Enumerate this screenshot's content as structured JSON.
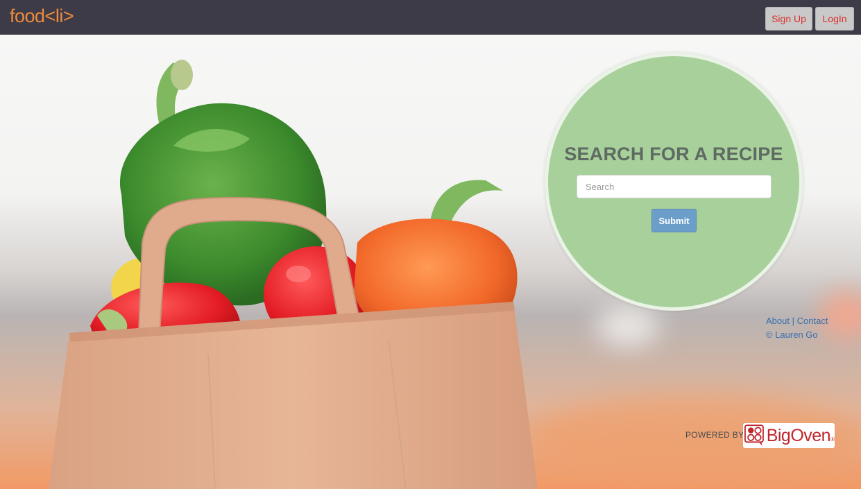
{
  "navbar": {
    "brand": "food<li>",
    "signup_label": "Sign Up",
    "login_label": "LogIn"
  },
  "search": {
    "title": "SEARCH FOR A RECIPE",
    "placeholder": "Search",
    "value": "",
    "submit_label": "Submit"
  },
  "footer": {
    "about_label": "About",
    "separator": "|",
    "contact_label": "Contact",
    "copyright": "© Lauren Go"
  },
  "powered_by": {
    "label": "POWERED BY",
    "logo_text": "BigOven",
    "logo_mark": "®"
  },
  "colors": {
    "navbar_bg": "#3c3b47",
    "brand": "#f08a3c",
    "nav_button_text": "#d9302c",
    "circle_bg": "#a8d09b",
    "submit_bg": "#6b9fc9",
    "link": "#3b6fb0",
    "bigoven_red": "#c0262c"
  },
  "icons": {
    "bigoven_logo": "bigoven-logo-icon"
  }
}
